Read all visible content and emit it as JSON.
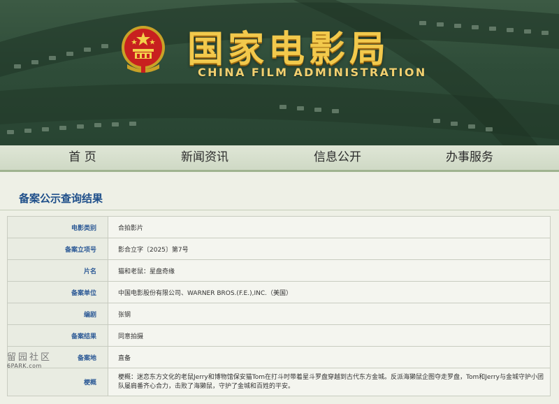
{
  "header": {
    "title_cn": "国家电影局",
    "title_en": "CHINA FILM ADMINISTRATION",
    "emblem_icon": "national-emblem-icon"
  },
  "nav": {
    "items": [
      {
        "label": "首 页"
      },
      {
        "label": "新闻资讯"
      },
      {
        "label": "信息公开"
      },
      {
        "label": "办事服务"
      }
    ]
  },
  "section": {
    "title": "备案公示查询结果"
  },
  "record": {
    "rows": [
      {
        "label": "电影类别",
        "value": "合拍影片"
      },
      {
        "label": "备案立项号",
        "value": "影合立字〔2025〕第7号"
      },
      {
        "label": "片名",
        "value": "猫和老鼠：星盘奇缘"
      },
      {
        "label": "备案单位",
        "value": "中国电影股份有限公司、WARNER BROS.(F.E.),INC.（美国）"
      },
      {
        "label": "编剧",
        "value": "张钢"
      },
      {
        "label": "备案结果",
        "value": "同意拍摄"
      },
      {
        "label": "备案地",
        "value": "直备"
      },
      {
        "label": "梗概",
        "value": "梗概：迷恋东方文化的老鼠Jerry和博物馆保安猫Tom在打斗时带着星斗罗盘穿越到古代东方金城。反派海獭鼠企图夺走罗盘，Tom和Jerry与金城守护小团队屡肩番齐心合力，击败了海獭鼠，守护了金城和百姓的平安。"
      }
    ]
  },
  "watermark": {
    "cn": "留园社区",
    "en": "6PARK.com"
  },
  "colors": {
    "banner_green": "#2f4d39",
    "title_gold": "#f2c94c",
    "label_blue": "#2d5a96",
    "nav_bg": "#dfe6d6"
  }
}
